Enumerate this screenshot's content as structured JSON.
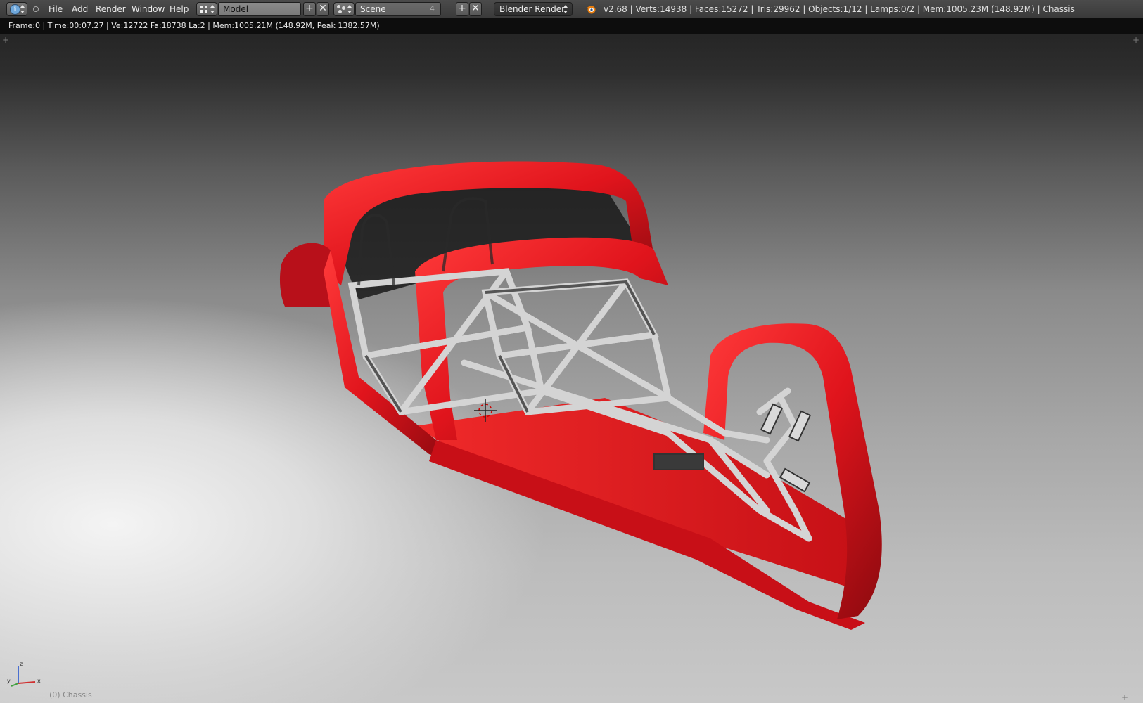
{
  "header": {
    "menus": [
      "File",
      "Add",
      "Render",
      "Window",
      "Help"
    ],
    "screen_layout": "Model",
    "scene": "Scene",
    "scene_users": "4",
    "render_engine": "Blender Render",
    "stats": "v2.68 | Verts:14938 | Faces:15272 | Tris:29962 | Objects:1/12 | Lamps:0/2 | Mem:1005.23M (148.92M) | Chassis"
  },
  "viewport": {
    "render_info": "Frame:0 | Time:00:07.27 | Ve:12722 Fa:18738 La:2 | Mem:1005.21M (148.92M, Peak 1382.57M)",
    "active_object_label": "(0) Chassis",
    "axes": {
      "x": "x",
      "y": "y",
      "z": "z"
    }
  },
  "colors": {
    "body_paint": "#e0141c",
    "frame_tube": "#d2d2d2",
    "header_bg": "#444444",
    "info_bar_bg": "#0d0d0d"
  },
  "icons": {
    "editor_type": "info-icon",
    "screen_layout": "screen-layout-icon",
    "scene": "scene-icon",
    "render": "blender-logo-icon"
  }
}
